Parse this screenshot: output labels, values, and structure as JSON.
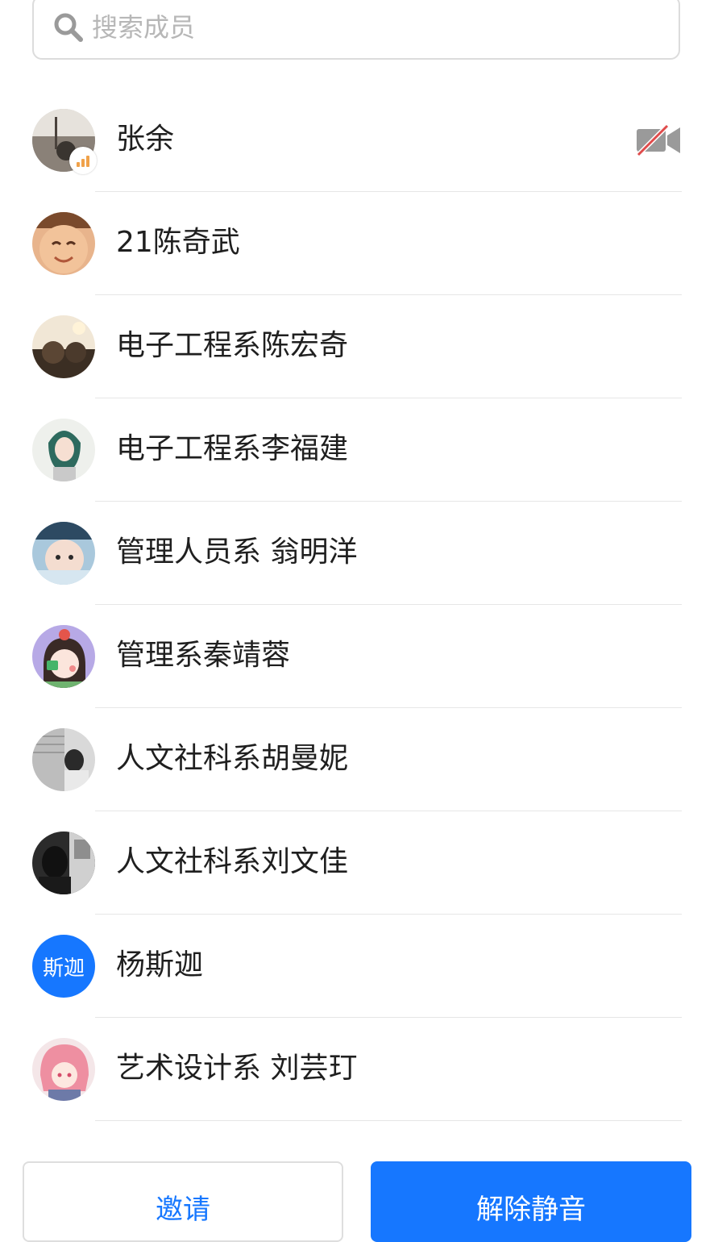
{
  "search": {
    "placeholder": "搜索成员"
  },
  "members": [
    {
      "name": "张余",
      "avatar": "photo",
      "speaking": true,
      "camera_off": true
    },
    {
      "name": "21陈奇武",
      "avatar": "photo"
    },
    {
      "name": "电子工程系陈宏奇",
      "avatar": "photo"
    },
    {
      "name": "电子工程系李福建",
      "avatar": "photo"
    },
    {
      "name": "管理人员系 翁明洋",
      "avatar": "photo"
    },
    {
      "name": "管理系秦靖蓉",
      "avatar": "photo"
    },
    {
      "name": "人文社科系胡曼妮",
      "avatar": "photo"
    },
    {
      "name": "人文社科系刘文佳",
      "avatar": "photo"
    },
    {
      "name": "杨斯迦",
      "avatar": "text",
      "avatar_text": "斯迦"
    },
    {
      "name": "艺术设计系 刘芸玎",
      "avatar": "photo"
    }
  ],
  "buttons": {
    "invite": "邀请",
    "unmute": "解除静音"
  },
  "colors": {
    "accent": "#1677ff",
    "text_avatar_bg": "#1677ff",
    "camera_off_slash": "#e04b4b"
  }
}
